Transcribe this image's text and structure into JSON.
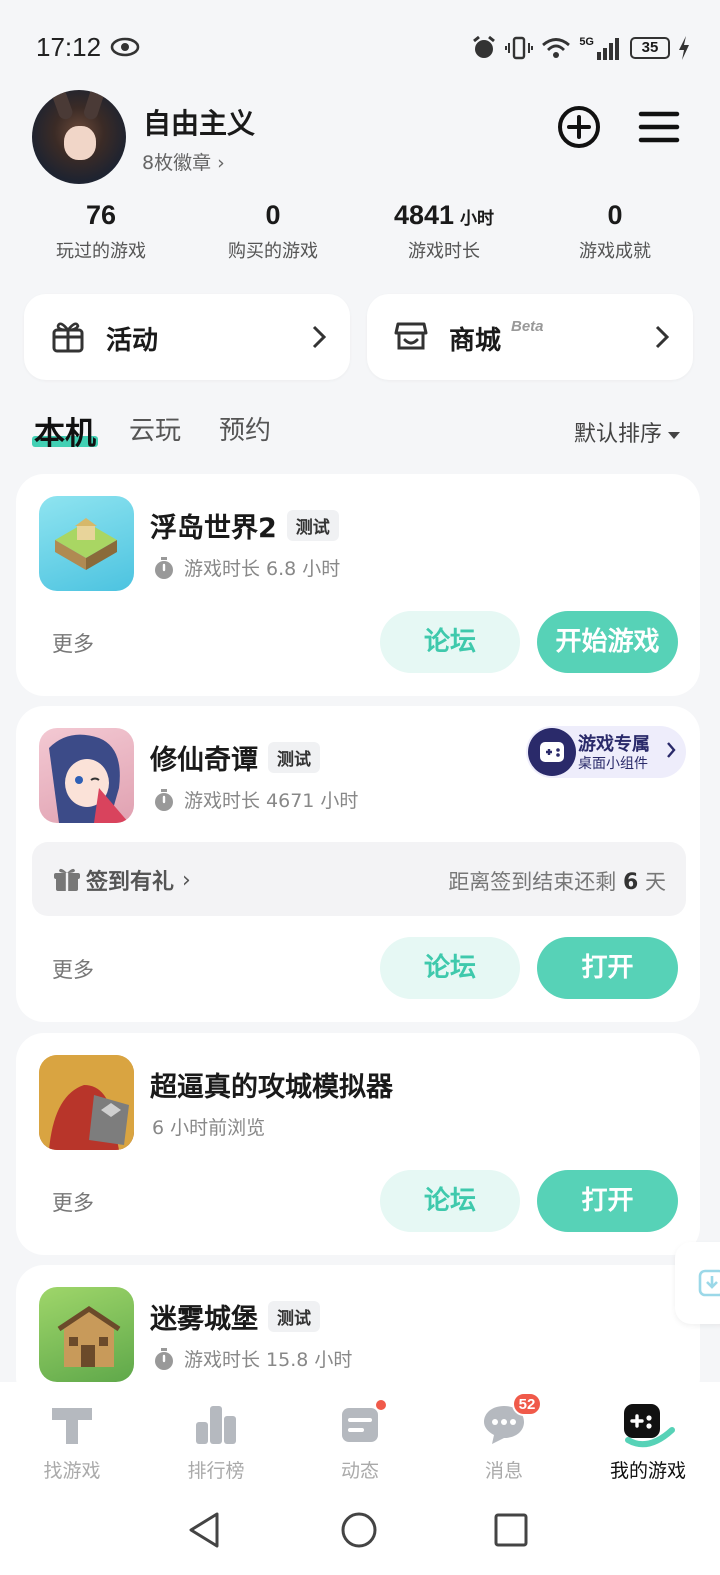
{
  "status_bar": {
    "time": "17:12",
    "battery": "35",
    "network": "5G"
  },
  "profile": {
    "name": "自由主义",
    "badges": "8枚徽章"
  },
  "stats": [
    {
      "value": "76",
      "unit": "",
      "label": "玩过的游戏"
    },
    {
      "value": "0",
      "unit": "",
      "label": "购买的游戏"
    },
    {
      "value": "4841",
      "unit": "小时",
      "label": "游戏时长"
    },
    {
      "value": "0",
      "unit": "",
      "label": "游戏成就"
    }
  ],
  "shortcuts": {
    "activity": "活动",
    "store": "商城",
    "store_badge": "Beta"
  },
  "tabs": {
    "local": "本机",
    "cloud": "云玩",
    "reserve": "预约",
    "sort": "默认排序"
  },
  "games": [
    {
      "name": "浮岛世界2",
      "tag": "测试",
      "sub": "游戏时长 6.8 小时",
      "more": "更多",
      "forum": "论坛",
      "action": "开始游戏"
    },
    {
      "name": "修仙奇谭",
      "tag": "测试",
      "sub": "游戏时长 4671 小时",
      "more": "更多",
      "forum": "论坛",
      "action": "打开",
      "signin": {
        "label": "签到有礼",
        "prefix": "距离签到结束还剩",
        "days": "6",
        "suffix": "天"
      },
      "widget": {
        "title": "游戏专属",
        "subtitle": "桌面小组件"
      }
    },
    {
      "name": "超逼真的攻城模拟器",
      "tag": "",
      "sub": "6 小时前浏览",
      "more": "更多",
      "forum": "论坛",
      "action": "打开"
    },
    {
      "name": "迷雾城堡",
      "tag": "测试",
      "sub": "游戏时长 15.8 小时"
    }
  ],
  "nav": [
    {
      "label": "找游戏"
    },
    {
      "label": "排行榜"
    },
    {
      "label": "动态"
    },
    {
      "label": "消息",
      "badge": "52"
    },
    {
      "label": "我的游戏"
    }
  ],
  "colors": {
    "accent": "#57d2b7",
    "accent_light": "#e6f8f4",
    "badge_red": "#f05a4a"
  }
}
